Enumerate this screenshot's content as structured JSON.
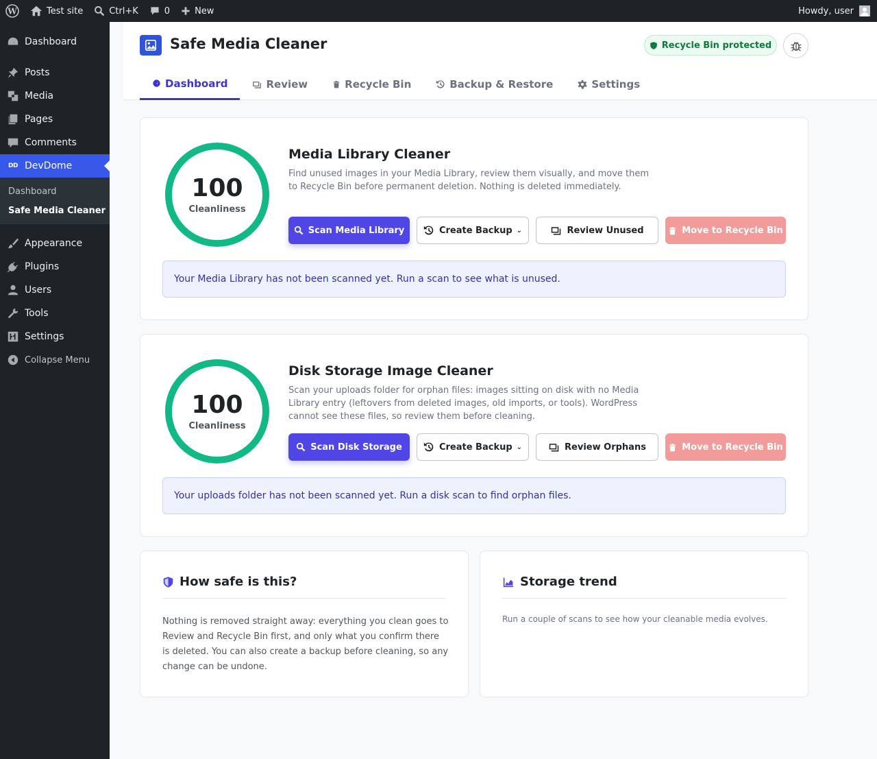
{
  "adminbar": {
    "site_name": "Test site",
    "search_shortcut": "Ctrl+K",
    "comments_count": "0",
    "new_label": "New",
    "greeting": "Howdy, user"
  },
  "sidebar": {
    "items": [
      {
        "label": "Dashboard",
        "icon": "dashboard-icon"
      },
      {
        "label": "Posts",
        "icon": "pushpin-icon"
      },
      {
        "label": "Media",
        "icon": "media-icon"
      },
      {
        "label": "Pages",
        "icon": "pages-icon"
      },
      {
        "label": "Comments",
        "icon": "comment-icon"
      },
      {
        "label": "DevDome",
        "icon": "devdome-icon",
        "badge": "DD"
      },
      {
        "label": "Appearance",
        "icon": "brush-icon"
      },
      {
        "label": "Plugins",
        "icon": "plug-icon"
      },
      {
        "label": "Users",
        "icon": "user-icon"
      },
      {
        "label": "Tools",
        "icon": "wrench-icon"
      },
      {
        "label": "Settings",
        "icon": "sliders-icon"
      }
    ],
    "submenu": [
      {
        "label": "Dashboard"
      },
      {
        "label": "Safe Media Cleaner"
      }
    ],
    "collapse_label": "Collapse Menu"
  },
  "header": {
    "title": "Safe Media Cleaner",
    "badge": "Recycle Bin protected",
    "tabs": [
      {
        "label": "Dashboard"
      },
      {
        "label": "Review"
      },
      {
        "label": "Recycle Bin"
      },
      {
        "label": "Backup & Restore"
      },
      {
        "label": "Settings"
      }
    ]
  },
  "cards": [
    {
      "score": "100",
      "score_label": "Cleanliness",
      "title": "Media Library Cleaner",
      "description": "Find unused images in your Media Library, review them visually, and move them to Recycle Bin before permanent deletion. Nothing is deleted immediately.",
      "scan_label": "Scan Media Library",
      "backup_label": "Create Backup",
      "review_label": "Review Unused",
      "recycle_label": "Move to Recycle Bin",
      "notice": "Your Media Library has not been scanned yet. Run a scan to see what is unused."
    },
    {
      "score": "100",
      "score_label": "Cleanliness",
      "title": "Disk Storage Image Cleaner",
      "description": "Scan your uploads folder for orphan files: images sitting on disk with no Media Library entry (leftovers from deleted images, old imports, or tools). WordPress cannot see these files, so review them before cleaning.",
      "scan_label": "Scan Disk Storage",
      "backup_label": "Create Backup",
      "review_label": "Review Orphans",
      "recycle_label": "Move to Recycle Bin",
      "notice": "Your uploads folder has not been scanned yet. Run a disk scan to find orphan files."
    }
  ],
  "safety": {
    "title": "How safe is this?",
    "text": "Nothing is removed straight away: everything you clean goes to Review and Recycle Bin first, and only what you confirm there is deleted. You can also create a backup before cleaning, so any change can be undone."
  },
  "trend": {
    "title": "Storage trend",
    "text": "Run a couple of scans to see how your cleanable media evolves."
  },
  "colors": {
    "accent": "#4f46e5",
    "ring": "#12b886",
    "danger": "#f19b9b",
    "sidebar_active": "#3858e9"
  }
}
